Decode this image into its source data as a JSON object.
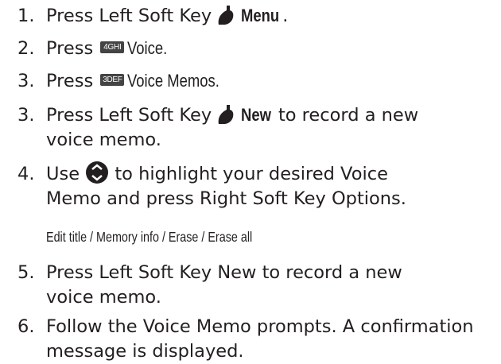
{
  "steps": [
    {
      "num": "1.",
      "pre": "Press Left Soft Key",
      "bold": "Menu",
      "post": "."
    },
    {
      "num": "2.",
      "pre": "Press",
      "key": "4GHI",
      "label": "Voice."
    },
    {
      "num": "3.",
      "pre": "Press",
      "key": "3DEF",
      "label": "Voice Memos."
    },
    {
      "num": "3.",
      "pre": "Press Left Soft Key",
      "bold": "New",
      "post": "to record a new",
      "line2": "voice memo."
    },
    {
      "num": "4.",
      "pre": "Use",
      "post": "to highlight your desired Voice",
      "line2": "Memo and press Right Soft Key Options."
    },
    {
      "num": "5.",
      "text": "Press Left Soft Key New to record a new",
      "line2": "voice memo."
    },
    {
      "num": "6.",
      "text": "Follow the Voice Memo prompts. A confirmation",
      "line2": "message is displayed."
    }
  ],
  "note": "Edit title / Memory info / Erase / Erase all",
  "icons": {
    "left_soft_key": "left-soft-key-icon",
    "nav_key": "navigation-key-icon",
    "key_4": "key-4-icon",
    "key_3": "key-3-icon"
  }
}
